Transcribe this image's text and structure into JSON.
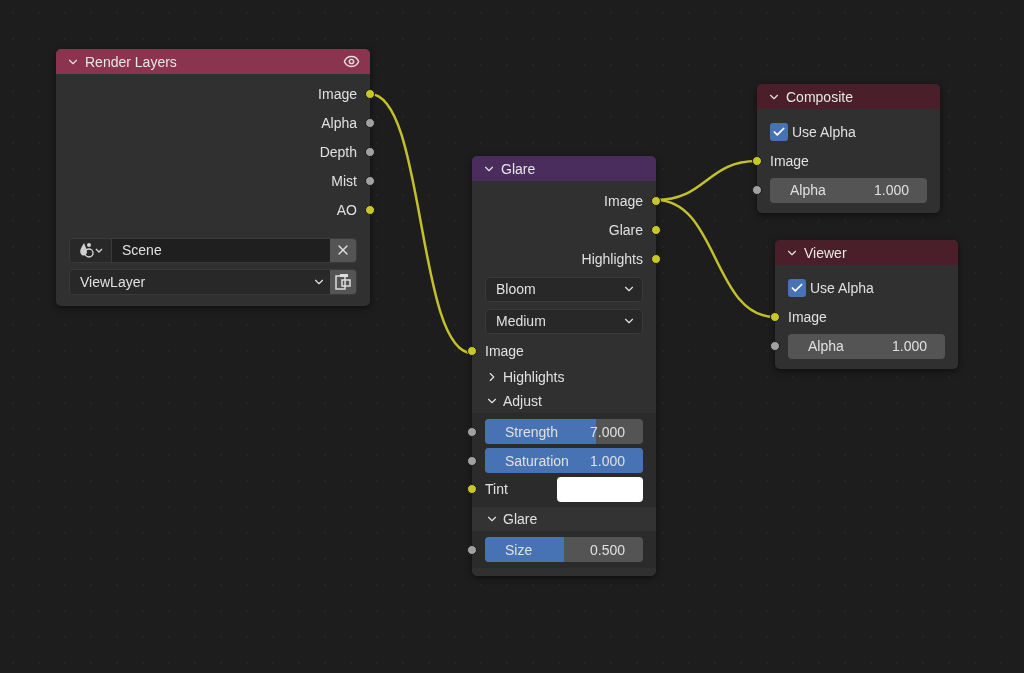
{
  "nodes": [
    {
      "kind": "render_layers",
      "title": "Render Layers",
      "color": "#8a3450",
      "rows": [
        {
          "kind": "output",
          "label": "Image",
          "socket": {
            "color": "#c7c72a"
          }
        },
        {
          "kind": "output",
          "label": "Alpha",
          "socket": {
            "color": "#a1a1a1"
          }
        },
        {
          "kind": "output",
          "label": "Depth",
          "socket": {
            "color": "#a1a1a1"
          }
        },
        {
          "kind": "output",
          "label": "Mist",
          "socket": {
            "color": "#a1a1a1"
          }
        },
        {
          "kind": "output",
          "label": "AO",
          "socket": {
            "color": "#c7c72a"
          }
        },
        {
          "kind": "scene",
          "value": "Scene"
        },
        {
          "kind": "layer",
          "value": "ViewLayer"
        }
      ]
    },
    {
      "kind": "glare",
      "title": "Glare",
      "color": "#4a2d5c",
      "rows": [
        {
          "kind": "output",
          "label": "Image",
          "socket": {
            "color": "#c7c72a"
          }
        },
        {
          "kind": "output",
          "label": "Glare",
          "socket": {
            "color": "#c7c72a"
          }
        },
        {
          "kind": "output",
          "label": "Highlights",
          "socket": {
            "color": "#c7c72a"
          }
        },
        {
          "kind": "dropdown",
          "value": "Bloom"
        },
        {
          "kind": "dropdown",
          "value": "Medium"
        },
        {
          "kind": "input",
          "label": "Image",
          "socket": {
            "color": "#c7c72a"
          }
        },
        {
          "kind": "panel",
          "label": "Highlights",
          "expanded": false
        },
        {
          "kind": "panel",
          "label": "Adjust",
          "expanded": true,
          "children": [
            {
              "kind": "slider",
              "label": "Strength",
              "value": "7.000",
              "level": 0.7,
              "socket": {
                "color": "#a1a1a1"
              }
            },
            {
              "kind": "slider",
              "label": "Saturation",
              "value": "1.000",
              "level": 1,
              "socket": {
                "color": "#a1a1a1"
              }
            },
            {
              "kind": "color",
              "label": "Tint",
              "swatch": {
                "color": "#ffffff"
              },
              "socket": {
                "color": "#c7c72a"
              }
            }
          ]
        },
        {
          "kind": "panel",
          "label": "Glare",
          "expanded": true,
          "children": [
            {
              "kind": "slider",
              "label": "Size",
              "value": "0.500",
              "level": 0.5,
              "socket": {
                "color": "#a1a1a1"
              }
            }
          ]
        }
      ]
    },
    {
      "kind": "output",
      "title": "Composite",
      "color": "#4a1f29",
      "rows": [
        {
          "kind": "checkbox",
          "label": "Use Alpha",
          "checked": true
        },
        {
          "kind": "input",
          "label": "Image",
          "socket": {
            "color": "#c7c72a"
          }
        },
        {
          "kind": "number",
          "label": "Alpha",
          "value": "1.000",
          "socket": {
            "color": "#a1a1a1"
          }
        }
      ]
    },
    {
      "kind": "output",
      "title": "Viewer",
      "color": "#4a1f29",
      "rows": [
        {
          "kind": "checkbox",
          "label": "Use Alpha",
          "checked": true
        },
        {
          "kind": "input",
          "label": "Image",
          "socket": {
            "color": "#c7c72a"
          }
        },
        {
          "kind": "number",
          "label": "Alpha",
          "value": "1.000",
          "socket": {
            "color": "#a1a1a1"
          }
        }
      ]
    }
  ]
}
